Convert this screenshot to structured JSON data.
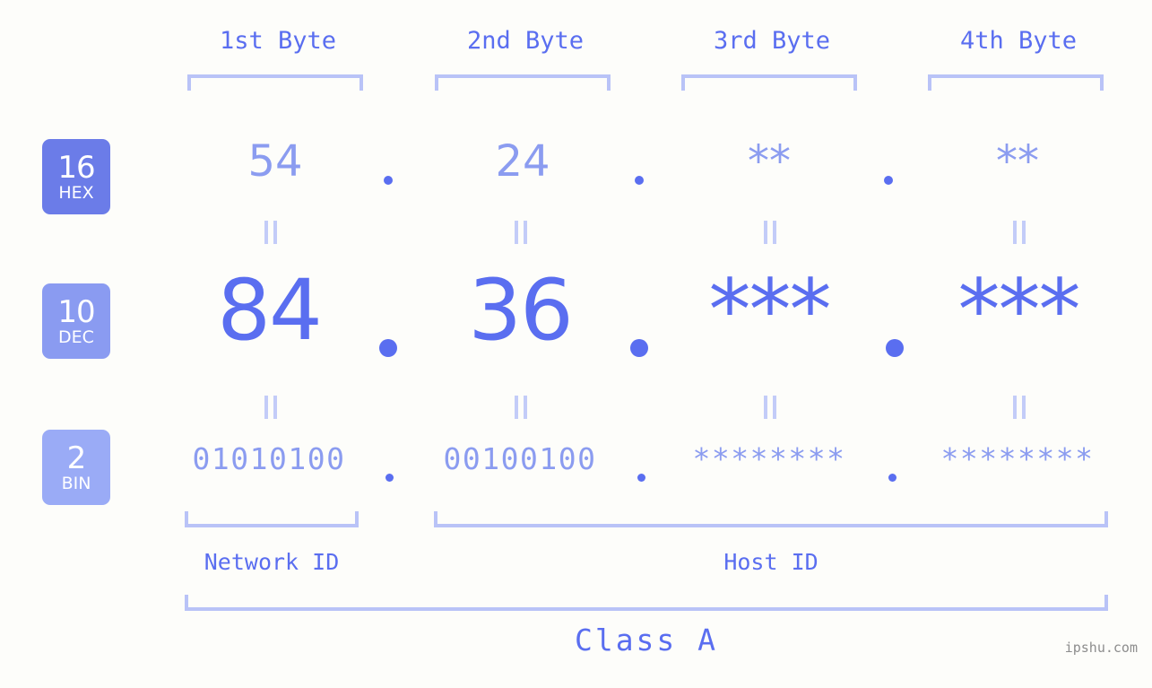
{
  "header": {
    "byte_labels": [
      "1st Byte",
      "2nd Byte",
      "3rd Byte",
      "4th Byte"
    ]
  },
  "radix_badges": [
    {
      "number": "16",
      "label": "HEX",
      "color": "#6b7ce8"
    },
    {
      "number": "10",
      "label": "DEC",
      "color": "#8a9bf1"
    },
    {
      "number": "2",
      "label": "BIN",
      "color": "#9aabf6"
    }
  ],
  "rows": {
    "hex": {
      "values": [
        "54",
        "24",
        "**",
        "**"
      ]
    },
    "dec": {
      "values": [
        "84",
        "36",
        "***",
        "***"
      ]
    },
    "bin": {
      "values": [
        "01010100",
        "00100100",
        "********",
        "********"
      ]
    }
  },
  "separators": {
    "glyph": "."
  },
  "equality_marks": {
    "glyph": "||"
  },
  "sections": {
    "network_id": "Network ID",
    "host_id": "Host ID",
    "class": "Class A"
  },
  "footer": {
    "watermark": "ipshu.com"
  },
  "colors": {
    "background": "#fdfdfa",
    "primary": "#5a6ef0",
    "secondary": "#8b9cf0",
    "bracket": "#b9c3f7"
  }
}
